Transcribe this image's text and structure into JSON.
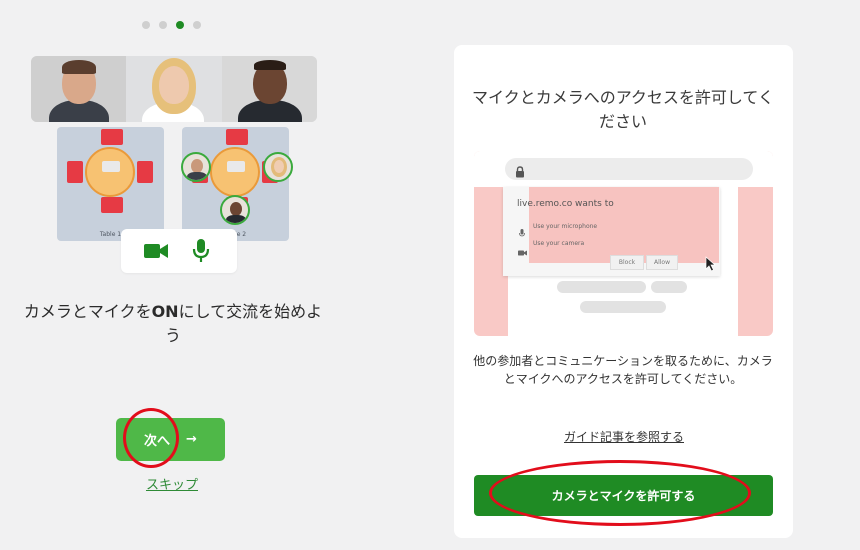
{
  "carousel": {
    "count": 4,
    "active_index": 2
  },
  "left": {
    "table_labels": [
      "Table 1",
      "Table 2"
    ],
    "main_text_pre": "カメラとマイクを",
    "main_text_bold": "ON",
    "main_text_post": "にして交流を始めよう",
    "next_button": {
      "label": "次へ",
      "arrow": "→"
    },
    "skip_link": "スキップ"
  },
  "right": {
    "title": "マイクとカメラへのアクセスを許可してください",
    "illustration": {
      "popup_title": "live.remo.co wants to",
      "items": [
        "Use your microphone",
        "Use your camera"
      ],
      "block_label": "Block",
      "allow_label": "Allow"
    },
    "description": "他の参加者とコミュニケーションを取るために、カメラとマイクへのアクセスを許可してください。",
    "guide_link": "ガイド記事を参照する",
    "allow_button": "カメラとマイクを許可する"
  },
  "colors": {
    "brand_green": "#1f8b24",
    "next_green": "#4fb848",
    "annotation_red": "#e20d1b",
    "illustration_pink": "#f9c9c6"
  },
  "icons": [
    "video-camera-icon",
    "microphone-icon",
    "lock-icon",
    "cursor-icon",
    "arrow-right-icon"
  ]
}
